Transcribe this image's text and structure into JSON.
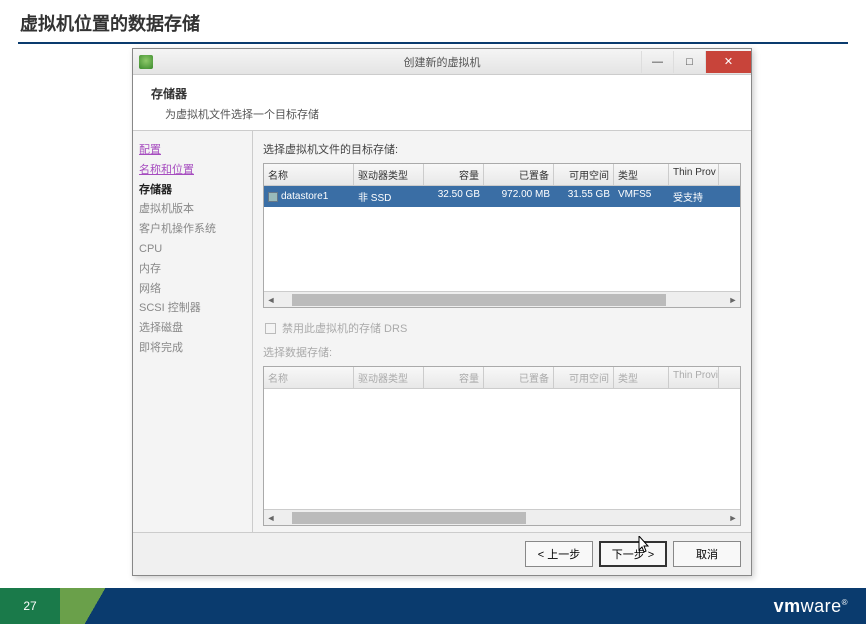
{
  "slide": {
    "title": "虚拟机位置的数据存储",
    "page": "27",
    "brand": "vmware"
  },
  "dialog": {
    "title": "创建新的虚拟机",
    "header_title": "存储器",
    "header_desc": "为虚拟机文件选择一个目标存储",
    "sidebar": {
      "items": [
        {
          "label": "配置",
          "kind": "link visited"
        },
        {
          "label": "名称和位置",
          "kind": "link visited"
        },
        {
          "label": "存储器",
          "kind": "current"
        },
        {
          "label": "虚拟机版本",
          "kind": ""
        },
        {
          "label": "客户机操作系统",
          "kind": ""
        },
        {
          "label": "CPU",
          "kind": ""
        },
        {
          "label": "内存",
          "kind": ""
        },
        {
          "label": "网络",
          "kind": ""
        },
        {
          "label": "SCSI 控制器",
          "kind": ""
        },
        {
          "label": "选择磁盘",
          "kind": ""
        },
        {
          "label": "即将完成",
          "kind": ""
        }
      ]
    },
    "table1": {
      "label": "选择虚拟机文件的目标存储:",
      "cols": {
        "name": "名称",
        "drive": "驱动器类型",
        "cap": "容量",
        "prov": "已置备",
        "free": "可用空间",
        "type": "类型",
        "thin": "Thin Prov"
      },
      "rows": [
        {
          "name": "datastore1",
          "drive": "非 SSD",
          "cap": "32.50 GB",
          "prov": "972.00 MB",
          "free": "31.55 GB",
          "type": "VMFS5",
          "thin": "受支持"
        }
      ]
    },
    "checkbox_label": "禁用此虚拟机的存储 DRS",
    "table2": {
      "label": "选择数据存储:",
      "cols": {
        "name": "名称",
        "drive": "驱动器类型",
        "cap": "容量",
        "prov": "已置备",
        "free": "可用空间",
        "type": "类型",
        "thin": "Thin Provi"
      }
    },
    "buttons": {
      "back": "< 上一步",
      "next": "下一步 >",
      "cancel": "取消"
    }
  }
}
